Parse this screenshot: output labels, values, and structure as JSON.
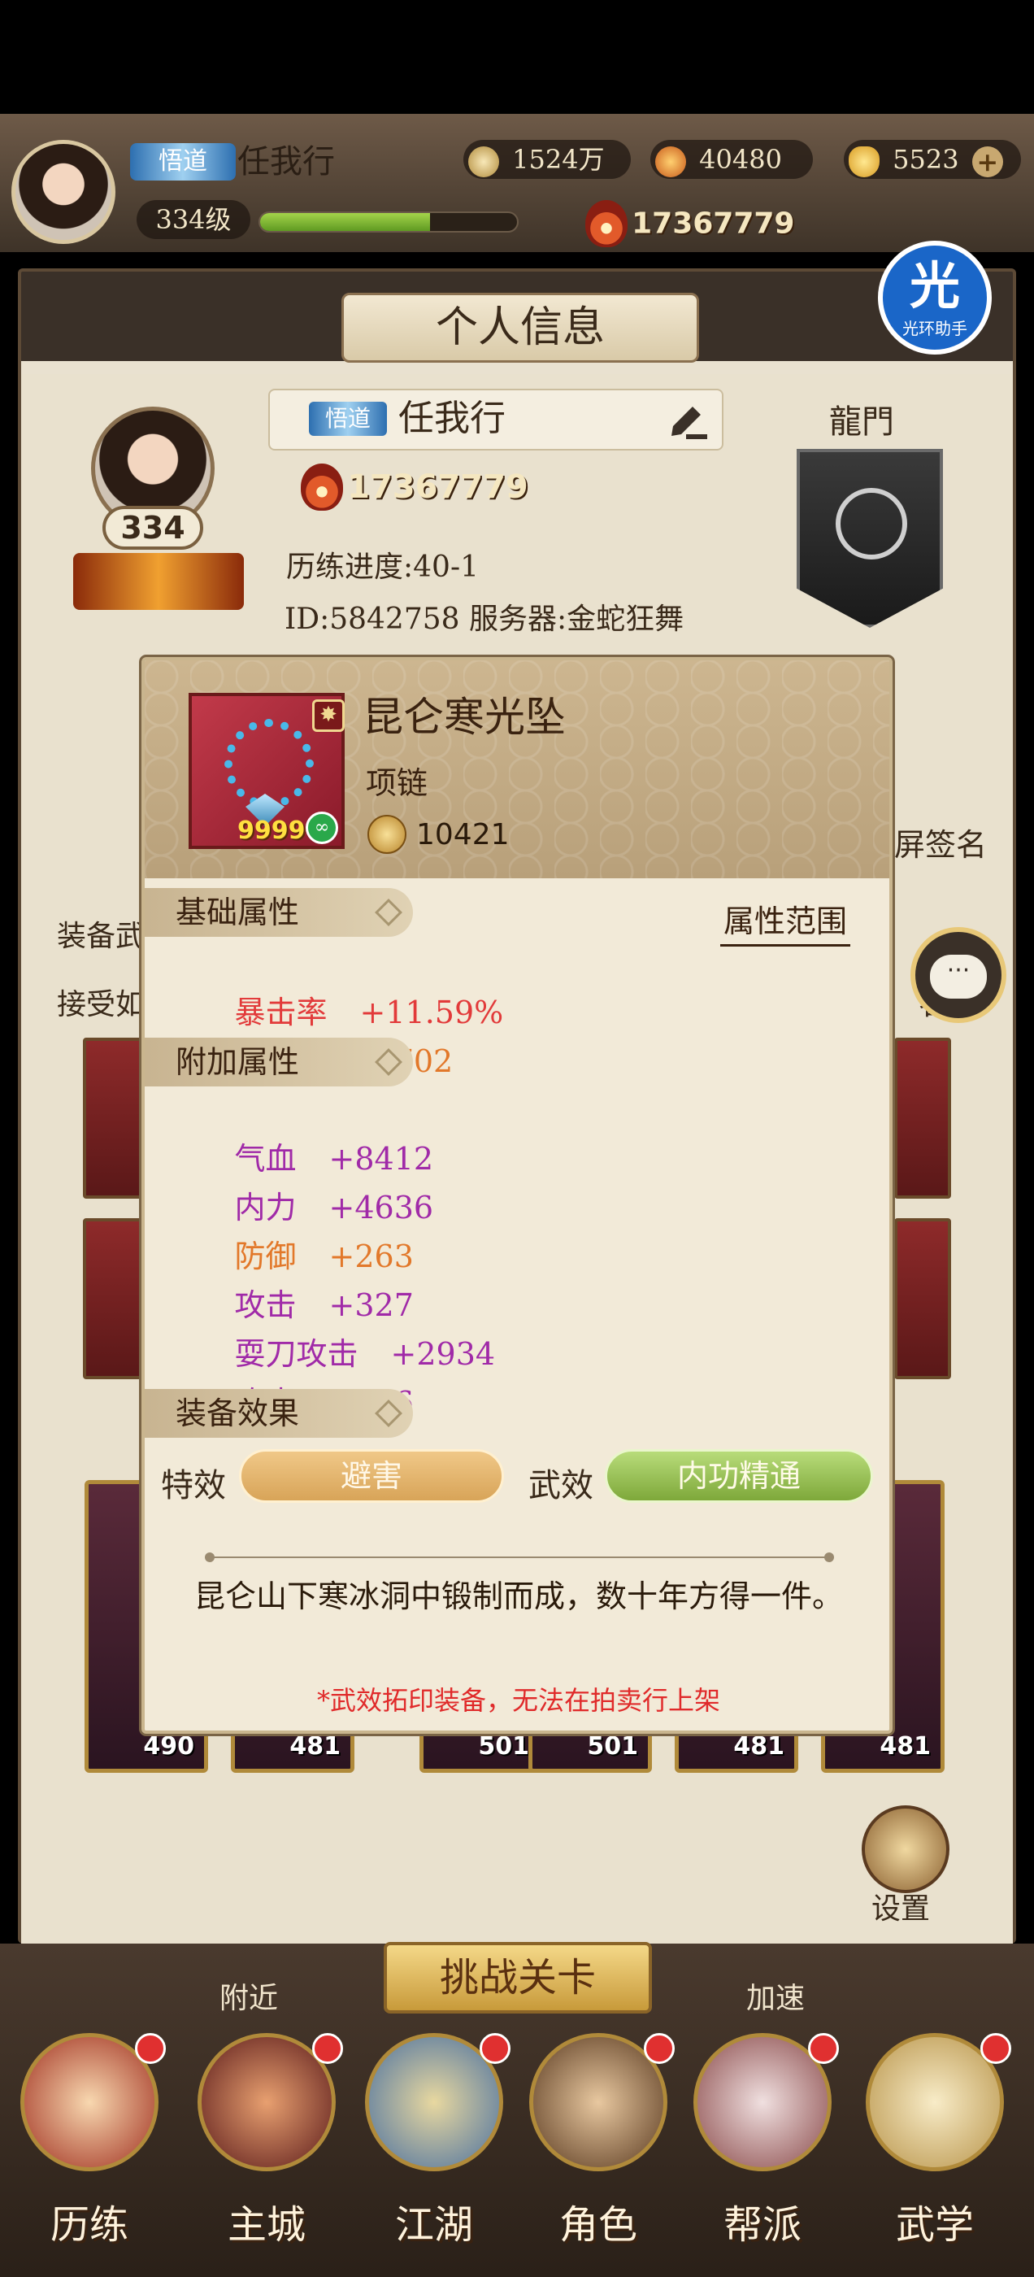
{
  "topbar": {
    "rank_badge": "悟道",
    "player_name": "任我行",
    "level": "334级",
    "xp_fraction": 0.66,
    "power": "17367779",
    "silver": "1524万",
    "gold": "40480",
    "ingot": "5523"
  },
  "panel": {
    "title": "个人信息",
    "profile_level": "334",
    "rank_badge": "悟道",
    "name": "任我行",
    "power": "17367779",
    "progress": "历练进度:40-1",
    "id_server": "ID:5842758   服务器:金蛇狂舞",
    "sect_title": "龍門",
    "side_labels": [
      "装备武",
      "接受如",
      "屏签名",
      "名"
    ],
    "card_levels": [
      "490",
      "481",
      "501",
      "501",
      "481",
      "481"
    ],
    "settings_label": "设置"
  },
  "helper": {
    "glyph": "光",
    "label": "光环助手"
  },
  "chat": {
    "glyph": "···"
  },
  "popup": {
    "item_name": "昆仑寒光坠",
    "item_type": "项链",
    "item_count": "9999",
    "item_power": "10421",
    "range_link": "属性范围",
    "sections": {
      "base": "基础属性",
      "extra": "附加属性",
      "effect": "装备效果"
    },
    "base_attrs": [
      {
        "name": "暴击率",
        "value": "+11.59%",
        "color": "#e23a3a"
      },
      {
        "name": "气血",
        "value": "+11702",
        "color": "#e2782a"
      }
    ],
    "extra_attrs": [
      {
        "name": "气血",
        "value": "+8412",
        "color": "#a02aa8"
      },
      {
        "name": "内力",
        "value": "+4636",
        "color": "#a02aa8"
      },
      {
        "name": "防御",
        "value": "+263",
        "color": "#e2782a"
      },
      {
        "name": "攻击",
        "value": "+327",
        "color": "#a02aa8"
      },
      {
        "name": "耍刀攻击",
        "value": "+2934",
        "color": "#a02aa8"
      },
      {
        "name": "攻击",
        "value": "+306",
        "color": "#a02aa8"
      }
    ],
    "effect_label": "特效",
    "effect_value": "避害",
    "martial_label": "武效",
    "martial_value": "内功精通",
    "description": "昆仑山下寒冰洞中锻制而成，数十年方得一件。",
    "notice": "*武效拓印装备，无法在拍卖行上架"
  },
  "bottom": {
    "challenge": "挑战关卡",
    "nearby": "附近",
    "speed": "加速",
    "nav": [
      "历练",
      "主城",
      "江湖",
      "角色",
      "帮派",
      "武学"
    ]
  }
}
